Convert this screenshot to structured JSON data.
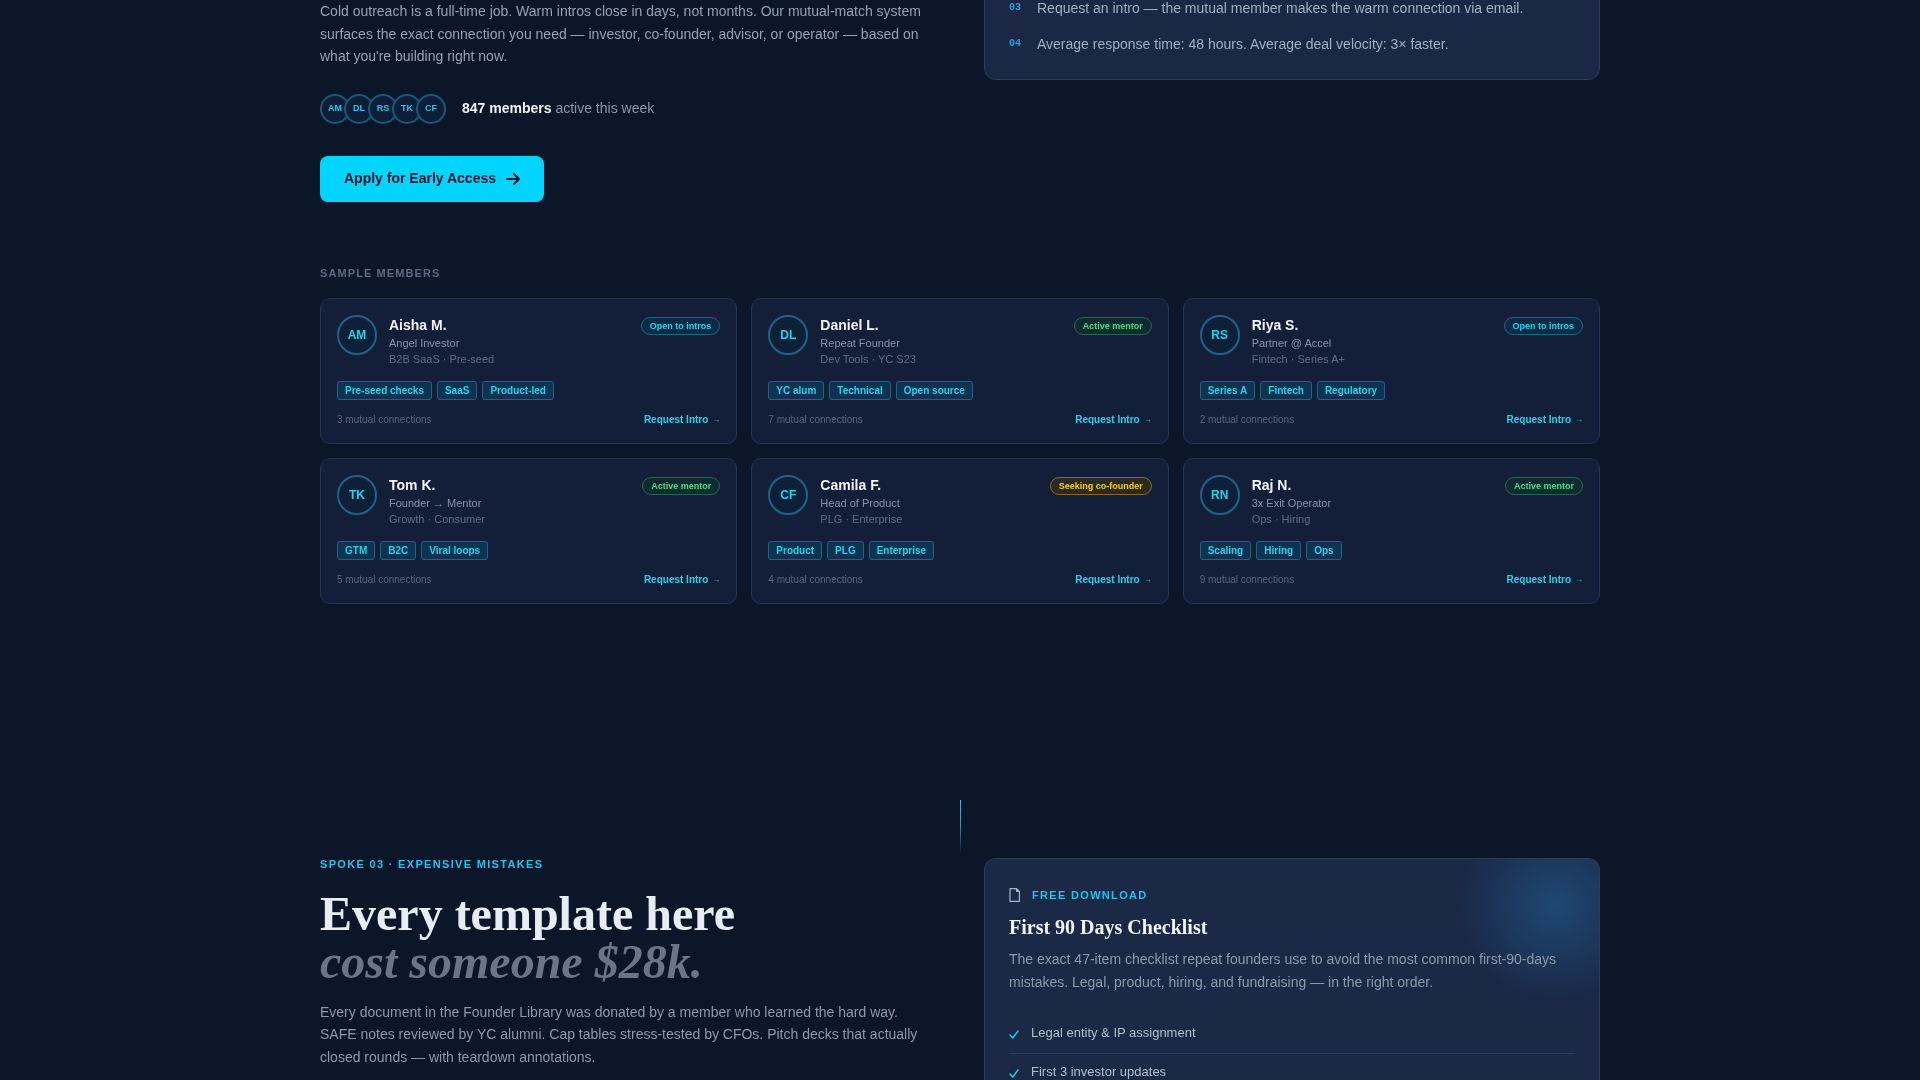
{
  "intro": {
    "paragraph": "Cold outreach is a full-time job. Warm intros close in days, not months. Our mutual-match system surfaces the exact connection you need — investor, co-founder, advisor, or operator — based on what you're building right now.",
    "members_row": {
      "avatars": [
        "AM",
        "DL",
        "RS",
        "TK",
        "CF"
      ],
      "text": "**847 members** active this week"
    },
    "cta": {
      "label": "Apply for Early Access"
    }
  },
  "steps_card": {
    "steps": [
      {
        "number": "03",
        "text": "Request an intro — the mutual member makes the warm connection via email."
      },
      {
        "number": "04",
        "text": "Average response time: 48 hours. Average deal velocity: 3× faster."
      }
    ]
  },
  "sample_members": {
    "heading": "SAMPLE MEMBERS",
    "members": [
      {
        "initials": "AM",
        "name": "Aisha M.",
        "role": "Angel Investor",
        "meta": "B2B SaaS · Pre-seed",
        "status": {
          "label": "Open to intros",
          "kind": "open"
        },
        "tags": [
          "Pre-seed checks",
          "SaaS",
          "Product-led"
        ],
        "mutual": "3 mutual connections",
        "action": {
          "label": "Request Intro",
          "arrow": "→"
        }
      },
      {
        "initials": "DL",
        "name": "Daniel L.",
        "role": "Repeat Founder",
        "meta": "Dev Tools · YC S23",
        "status": {
          "label": "Active mentor",
          "kind": "mentor"
        },
        "tags": [
          "YC alum",
          "Technical",
          "Open source"
        ],
        "mutual": "7 mutual connections",
        "action": {
          "label": "Request Intro",
          "arrow": "→"
        }
      },
      {
        "initials": "RS",
        "name": "Riya S.",
        "role": "Partner @ Accel",
        "meta": "Fintech · Series A+",
        "status": {
          "label": "Open to intros",
          "kind": "open"
        },
        "tags": [
          "Series A",
          "Fintech",
          "Regulatory"
        ],
        "mutual": "2 mutual connections",
        "action": {
          "label": "Request Intro",
          "arrow": "→"
        }
      },
      {
        "initials": "TK",
        "name": "Tom K.",
        "role": "Founder → Mentor",
        "meta": "Growth · Consumer",
        "status": {
          "label": "Active mentor",
          "kind": "mentor"
        },
        "tags": [
          "GTM",
          "B2C",
          "Viral loops"
        ],
        "mutual": "5 mutual connections",
        "action": {
          "label": "Request Intro",
          "arrow": "→"
        }
      },
      {
        "initials": "CF",
        "name": "Camila F.",
        "role": "Head of Product",
        "meta": "PLG · Enterprise",
        "status": {
          "label": "Seeking co-founder",
          "kind": "seeking"
        },
        "tags": [
          "Product",
          "PLG",
          "Enterprise"
        ],
        "mutual": "4 mutual connections",
        "action": {
          "label": "Request Intro",
          "arrow": "→"
        }
      },
      {
        "initials": "RN",
        "name": "Raj N.",
        "role": "3x Exit Operator",
        "meta": "Ops · Hiring",
        "status": {
          "label": "Active mentor",
          "kind": "mentor"
        },
        "tags": [
          "Scaling",
          "Hiring",
          "Ops"
        ],
        "mutual": "9 mutual connections",
        "action": {
          "label": "Request Intro",
          "arrow": "→"
        }
      }
    ]
  },
  "spoke": {
    "eyebrow": "SPOKE 03 · EXPENSIVE MISTAKES",
    "heading": "Every template here *cost someone $28k.*",
    "paragraph": "Every document in the Founder Library was donated by a member who learned the hard way. SAFE notes reviewed by YC alumni. Cap tables stress-tested by CFOs. Pitch decks that actually closed rounds — with teardown annotations."
  },
  "download_card": {
    "eyebrow": "FREE DOWNLOAD",
    "title": "First 90 Days Checklist",
    "description": "The exact 47-item checklist repeat founders use to avoid the most common first-90-days mistakes. Legal, product, hiring, and fundraising — in the right order.",
    "items": [
      {
        "text": "Legal entity & IP assignment",
        "checked": true
      },
      {
        "text": "First 3 investor updates",
        "checked": true
      }
    ]
  }
}
